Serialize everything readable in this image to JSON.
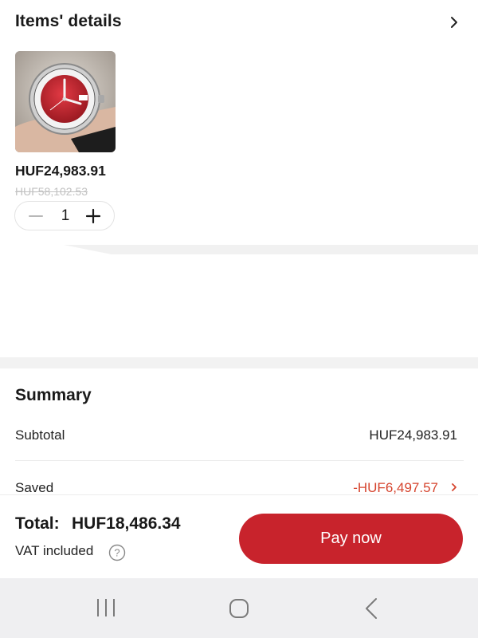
{
  "items": {
    "title": "Items' details",
    "chevron_icon": "chevron-right-icon",
    "product": {
      "image_icon": "red-dial-wristwatch-photo",
      "price": "HUF24,983.91",
      "original_price": "HUF58,102.53",
      "quantity": "1",
      "minus_icon": "minus-icon",
      "plus_icon": "plus-icon"
    }
  },
  "summary": {
    "title": "Summary",
    "subtotal_label": "Subtotal",
    "subtotal_value": "HUF24,983.91",
    "saved_label": "Saved",
    "saved_value": "-HUF6,497.57",
    "saved_color": "#d6452f"
  },
  "footer": {
    "total_label": "Total:",
    "total_value": "HUF18,486.34",
    "vat_label": "VAT included",
    "pay_button": "Pay now",
    "pay_color": "#c8232c"
  },
  "system_nav": {
    "recents_icon": "recents-icon",
    "home_icon": "home-icon",
    "back_icon": "back-icon"
  }
}
